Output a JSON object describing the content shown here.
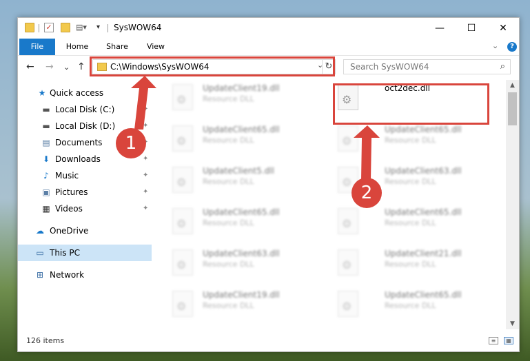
{
  "window": {
    "title": "SysWOW64",
    "minimize_glyph": "—",
    "maximize_glyph": "☐",
    "close_glyph": "✕"
  },
  "ribbon": {
    "tabs": [
      "File",
      "Home",
      "Share",
      "View"
    ],
    "expand_glyph": "⌄",
    "help_glyph": "?"
  },
  "nav": {
    "back": "←",
    "forward": "→",
    "recent": "⌄",
    "up": "↑",
    "address": "C:\\Windows\\SysWOW64",
    "address_dropdown": "⌄",
    "refresh": "↻",
    "search_placeholder": "Search SysWOW64",
    "search_icon": "⌕"
  },
  "sidebar": {
    "items": [
      {
        "label": "Quick access",
        "icon": "star-icon",
        "glyph": "★",
        "color": "#1979ca"
      },
      {
        "label": "Local Disk (C:)",
        "icon": "drive-icon",
        "glyph": "▬",
        "color": "#555555",
        "pinned": true
      },
      {
        "label": "Local Disk (D:)",
        "icon": "drive-icon",
        "glyph": "▬",
        "color": "#555555",
        "pinned": true
      },
      {
        "label": "Documents",
        "icon": "documents-icon",
        "glyph": "▤",
        "color": "#5b7fa6",
        "pinned": true
      },
      {
        "label": "Downloads",
        "icon": "download-icon",
        "glyph": "⬇",
        "color": "#1979ca",
        "pinned": true
      },
      {
        "label": "Music",
        "icon": "music-icon",
        "glyph": "♪",
        "color": "#1979ca",
        "pinned": true
      },
      {
        "label": "Pictures",
        "icon": "pictures-icon",
        "glyph": "▣",
        "color": "#5b7fa6",
        "pinned": true
      },
      {
        "label": "Videos",
        "icon": "videos-icon",
        "glyph": "▦",
        "color": "#333333",
        "pinned": true
      },
      {
        "label": "OneDrive",
        "icon": "cloud-icon",
        "glyph": "☁",
        "color": "#1979ca"
      },
      {
        "label": "This PC",
        "icon": "computer-icon",
        "glyph": "▭",
        "color": "#3a6ea5",
        "selected": true
      },
      {
        "label": "Network",
        "icon": "network-icon",
        "glyph": "⊞",
        "color": "#3a6ea5"
      }
    ],
    "pin_glyph": "📌"
  },
  "files": {
    "left_column": [
      {
        "name": "UpdateClient19.dll",
        "type": "Resource DLL"
      },
      {
        "name": "UpdateClient65.dll",
        "type": "Resource DLL"
      },
      {
        "name": "UpdateClient5.dll",
        "type": "Resource DLL"
      },
      {
        "name": "UpdateClient65.dll",
        "type": "Resource DLL"
      },
      {
        "name": "UpdateClient63.dll",
        "type": "Resource DLL"
      },
      {
        "name": "UpdateClient19.dll",
        "type": "Resource DLL"
      }
    ],
    "right_column": [
      {
        "name": "oct2dec.dll",
        "type": ""
      },
      {
        "name": "UpdateClient65.dll",
        "type": "Resource DLL"
      },
      {
        "name": "UpdateClient63.dll",
        "type": "Resource DLL"
      },
      {
        "name": "UpdateClient65.dll",
        "type": "Resource DLL"
      },
      {
        "name": "UpdateClient21.dll",
        "type": "Resource DLL"
      },
      {
        "name": "UpdateClient65.dll",
        "type": "Resource DLL"
      }
    ]
  },
  "status": {
    "item_count": "126 items"
  },
  "annotations": {
    "marker1": "1",
    "marker2": "2",
    "color": "#d9453c"
  },
  "colors": {
    "accent": "#1979ca",
    "selection": "#cce4f7"
  }
}
